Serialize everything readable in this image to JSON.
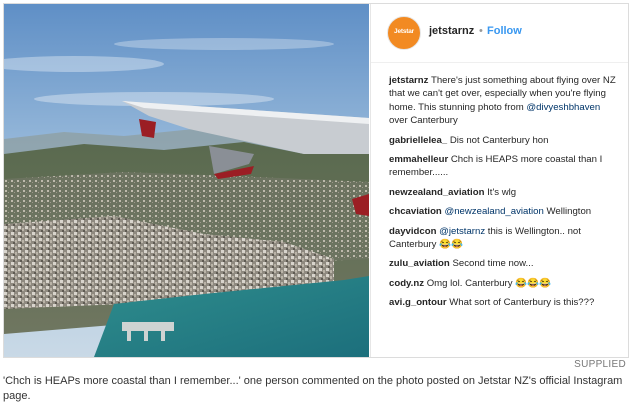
{
  "post": {
    "username": "jetstarnz",
    "separator": "•",
    "follow_label": "Follow",
    "avatar_text": "Jetstar"
  },
  "comments": [
    {
      "user": "jetstarnz",
      "text": "There's just something about flying over NZ that we can't get over, especially when you're flying home. This stunning photo from ",
      "mention": "@divyeshbhaven",
      "text_after": " over Canterbury"
    },
    {
      "user": "gabriellelea_",
      "text": "Dis not Canterbury hon"
    },
    {
      "user": "emmahelleur",
      "text": "Chch is HEAPS more coastal than I remember......"
    },
    {
      "user": "newzealand_aviation",
      "text": "It's wlg"
    },
    {
      "user": "chcaviation",
      "mention": "@newzealand_aviation",
      "text_after": " Wellington"
    },
    {
      "user": "dayvidcon",
      "mention": "@jetstarnz",
      "text_after": " this is Wellington.. not Canterbury 😂😂"
    },
    {
      "user": "zulu_aviation",
      "text": "Second time now..."
    },
    {
      "user": "cody.nz",
      "text": "Omg lol. Canterbury 😂😂😂"
    },
    {
      "user": "avi.g_ontour",
      "text": "What sort of Canterbury is this???"
    }
  ],
  "credit": "SUPPLIED",
  "caption": "'Chch is HEAPs more coastal than I remember...' one person commented on the photo posted on Jetstar NZ's official Instagram page."
}
